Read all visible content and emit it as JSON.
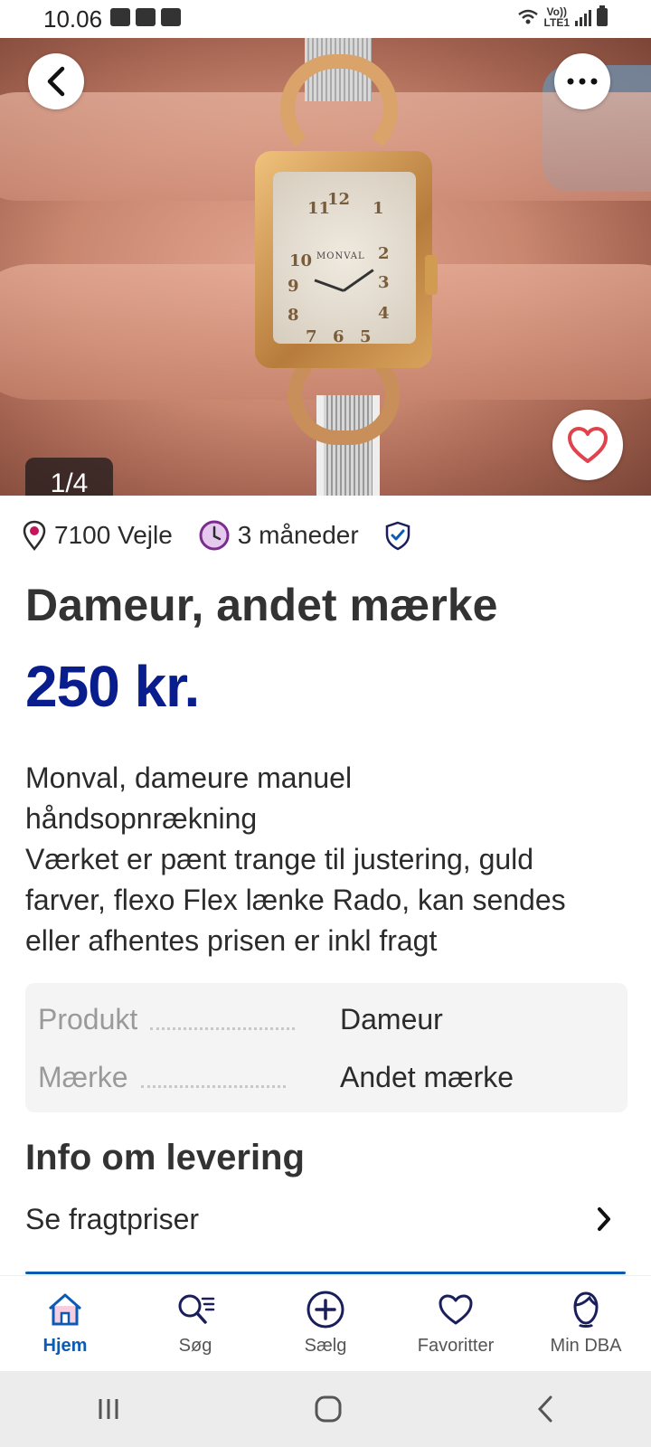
{
  "status_bar": {
    "time": "10.06",
    "network_top": "Vo))",
    "network_bottom": "LTE1"
  },
  "gallery": {
    "counter": "1/4",
    "watch_dial_brand": "MONVAL"
  },
  "meta": {
    "location": "7100 Vejle",
    "age": "3 måneder"
  },
  "listing": {
    "title": "Dameur, andet mærke",
    "price": "250 kr.",
    "description_lines": [
      "Monval, dameure manuel",
      "håndsopnrækning",
      "Værket er pænt trange til justering, guld",
      "farver, flexo Flex lænke Rado, kan sendes",
      "eller afhentes prisen er inkl fragt"
    ]
  },
  "specs": [
    {
      "key": "Produkt",
      "value": "Dameur"
    },
    {
      "key": "Mærke",
      "value": "Andet mærke"
    }
  ],
  "delivery": {
    "title": "Info om levering",
    "shipping_link": "Se fragtpriser"
  },
  "bottom_nav": [
    {
      "label": "Hjem",
      "icon": "home-icon",
      "active": true
    },
    {
      "label": "Søg",
      "icon": "search-icon",
      "active": false
    },
    {
      "label": "Sælg",
      "icon": "plus-circle-icon",
      "active": false
    },
    {
      "label": "Favoritter",
      "icon": "heart-icon",
      "active": false
    },
    {
      "label": "Min DBA",
      "icon": "profile-icon",
      "active": false
    }
  ],
  "colors": {
    "price": "#0a1d8c",
    "accent": "#0b5bb5",
    "heart": "#e0434b",
    "location_pin": "#c2185b",
    "clock": "#7b2d8e"
  }
}
